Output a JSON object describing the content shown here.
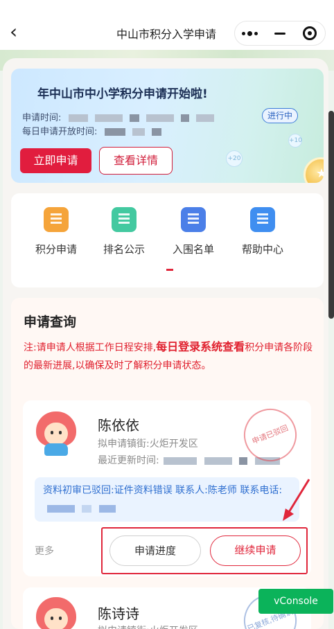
{
  "nav": {
    "title": "中山市积分入学申请",
    "back_icon": "back-arrow-icon"
  },
  "banner": {
    "headline": "年中山市中小学积分申请开始啦!",
    "apply_time_label": "申请时间:",
    "daily_open_label": "每日申请开放时间:",
    "status": "进行中",
    "apply_button": "立即申请",
    "detail_button": "查看详情",
    "bubble_a": "+10",
    "bubble_b": "+20"
  },
  "menu": {
    "items": [
      {
        "label": "积分申请",
        "icon": "points-apply-icon",
        "color": "#f5a43a"
      },
      {
        "label": "排名公示",
        "icon": "ranking-board-icon",
        "color": "#43c9a0"
      },
      {
        "label": "入围名单",
        "icon": "shortlist-icon",
        "color": "#4b7fe8"
      },
      {
        "label": "帮助中心",
        "icon": "help-center-icon",
        "color": "#3f8ef0"
      }
    ]
  },
  "query": {
    "title": "申请查询",
    "note_prefix": "注:请申请人根据工作日程安排,",
    "note_bold": "每日登录系统查看",
    "note_suffix": "积分申请各阶段的最新进展,以确保及时了解积分申请状态。"
  },
  "applications": [
    {
      "name": "陈依依",
      "street": "拟申请镇街:火炬开发区",
      "updated_label": "最近更新时间:",
      "stamp": "申请已驳回",
      "info_line": "资料初审已驳回:证件资料错误 联系人:陈老师 联系电话:",
      "more": "更多",
      "progress_button": "申请进度",
      "continue_button": "继续申请"
    },
    {
      "name": "陈诗诗",
      "street": "拟申请镇街:火炬开发区",
      "stamp": "已复核,待确认"
    }
  ],
  "debug": {
    "vconsole": "vConsole"
  },
  "colors": {
    "primary_red": "#e11d3e",
    "info_blue": "#2f6fd0",
    "vconsole_green": "#0bb35a"
  }
}
